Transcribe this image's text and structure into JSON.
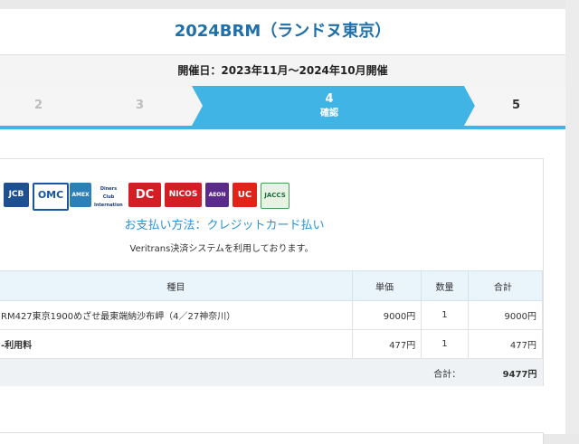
{
  "header": {
    "title": "2024BRM（ランドヌ東京）",
    "period": "開催日：2023年11月～2024年10月開催"
  },
  "steps": [
    {
      "num": "2",
      "label": ""
    },
    {
      "num": "3",
      "label": ""
    },
    {
      "num": "4",
      "label": "確認"
    },
    {
      "num": "5",
      "label": ""
    }
  ],
  "payment": {
    "logos": [
      "JCB",
      "OMC",
      "AMEX",
      "Diners Club International",
      "DC",
      "NICOS",
      "AEON",
      "UC",
      "JACCS"
    ],
    "method": "お支払い方法：クレジットカード払い",
    "note": "Veritrans決済システムを利用しております。"
  },
  "table": {
    "headers": {
      "name": "種目",
      "price": "単価",
      "qty": "数量",
      "sum": "合計"
    },
    "rows": [
      {
        "name": "RM427東京1900めざせ最東端納沙布岬（4／27神奈川）",
        "price": "9000円",
        "qty": "1",
        "sum": "9000円",
        "bold": false
      },
      {
        "name": "-利用料",
        "price": "477円",
        "qty": "1",
        "sum": "477円",
        "bold": true
      }
    ],
    "total_label": "合計：",
    "total_value": "9477円"
  },
  "colors": {
    "accent": "#41b4e6",
    "title": "#1f6fa8",
    "link": "#2a93d5"
  }
}
